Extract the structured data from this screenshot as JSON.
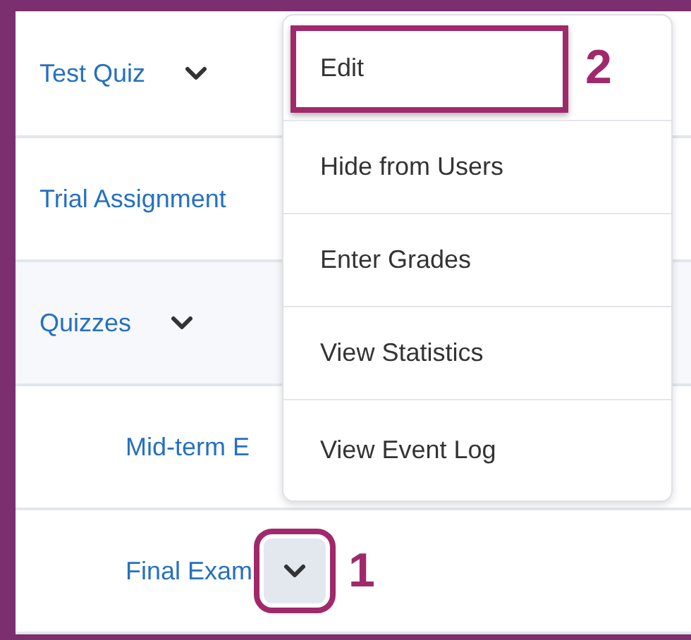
{
  "rows": [
    {
      "label": "Test Quiz",
      "kind": "item",
      "menu_button": true,
      "open": false
    },
    {
      "label": "Trial Assignment",
      "kind": "item",
      "menu_button": false
    },
    {
      "label": "Quizzes",
      "kind": "category",
      "menu_button": true,
      "open": false,
      "children": [
        {
          "label": "Mid-term E",
          "kind": "item"
        },
        {
          "label": "Final Exam",
          "kind": "item",
          "menu_button": true,
          "open": true,
          "callout": "1"
        }
      ]
    }
  ],
  "menu": {
    "items": [
      {
        "label": "Edit",
        "callout": "2"
      },
      {
        "label": "Hide from Users"
      },
      {
        "label": "Enter Grades"
      },
      {
        "label": "View Statistics"
      },
      {
        "label": "View Event Log"
      }
    ]
  }
}
